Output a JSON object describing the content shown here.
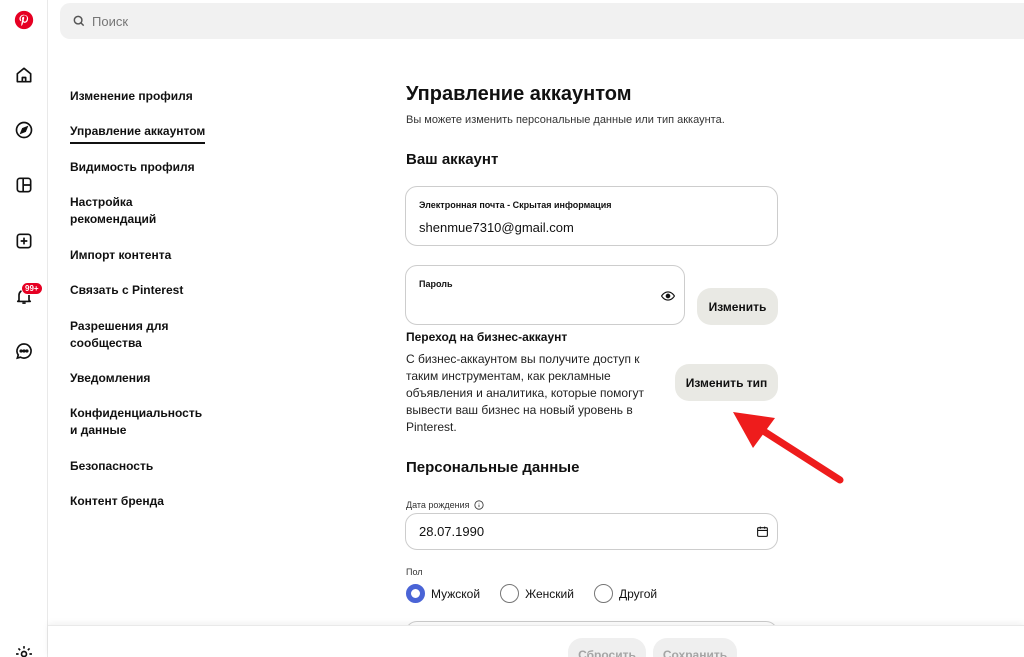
{
  "search": {
    "placeholder": "Поиск"
  },
  "rail": {
    "notifications_badge": "99+"
  },
  "nav": {
    "items": [
      {
        "label": "Изменение профиля"
      },
      {
        "label": "Управление аккаунтом"
      },
      {
        "label": "Видимость профиля"
      },
      {
        "label": "Настройка рекомендаций"
      },
      {
        "label": "Импорт контента"
      },
      {
        "label": "Связать с Pinterest"
      },
      {
        "label": "Разрешения для сообщества"
      },
      {
        "label": "Уведомления"
      },
      {
        "label": "Конфиденциальность и данные"
      },
      {
        "label": "Безопасность"
      },
      {
        "label": "Контент бренда"
      }
    ],
    "active_index": 1
  },
  "main": {
    "title": "Управление аккаунтом",
    "subtitle": "Вы можете изменить персональные данные или тип аккаунта.",
    "account_heading": "Ваш аккаунт",
    "email": {
      "label": "Электронная почта - Скрытая информация",
      "value": "shenmue7310@gmail.com"
    },
    "password": {
      "label": "Пароль",
      "value": ""
    },
    "change_button": "Изменить",
    "business": {
      "title": "Переход на бизнес-аккаунт",
      "description": "С бизнес-аккаунтом вы получите доступ к таким инструментам, как рекламные объявления и аналитика, которые помогут вывести ваш бизнес на новый уровень в Pinterest.",
      "button": "Изменить тип"
    },
    "personal_heading": "Персональные данные",
    "birthdate": {
      "label": "Дата рождения",
      "value": "28.07.1990"
    },
    "gender": {
      "label": "Пол",
      "options": [
        "Мужской",
        "Женский",
        "Другой"
      ],
      "selected_index": 0
    }
  },
  "footer": {
    "reset": "Сбросить",
    "save": "Сохранить"
  },
  "colors": {
    "brand": "#e60023",
    "radio": "#4a64d6",
    "annotation_arrow": "#ee1c1c"
  }
}
